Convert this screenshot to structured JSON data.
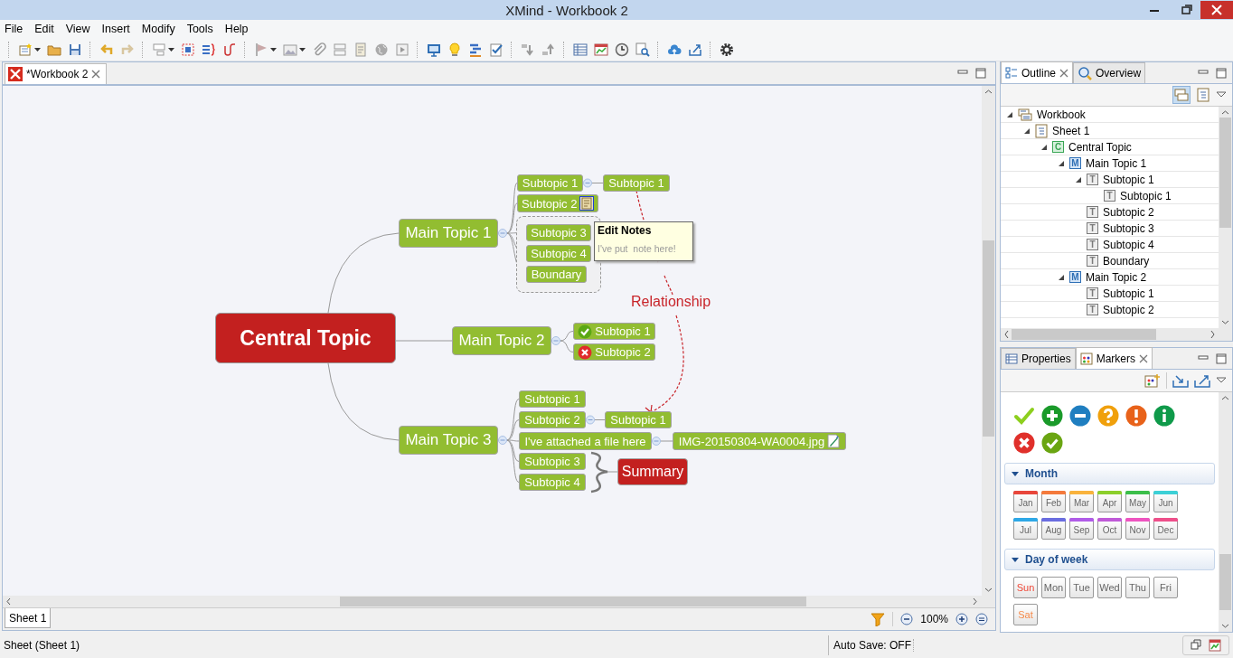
{
  "window": {
    "title": "XMind - Workbook 2"
  },
  "menu": [
    "File",
    "Edit",
    "View",
    "Insert",
    "Modify",
    "Tools",
    "Help"
  ],
  "editor": {
    "tabs": [
      {
        "label": "*Workbook 2",
        "selected": true
      }
    ],
    "mind_map": {
      "central_topic": "Central Topic",
      "main_topics": [
        {
          "label": "Main Topic 1",
          "subtopics": [
            {
              "label": "Subtopic 1",
              "children": [
                {
                  "label": "Subtopic 1"
                }
              ]
            },
            {
              "label": "Subtopic 2",
              "note": true
            },
            {
              "label": "Subtopic 3"
            },
            {
              "label": "Subtopic 4"
            },
            {
              "label": "Boundary"
            }
          ]
        },
        {
          "label": "Main Topic 2",
          "subtopics": [
            {
              "label": "Subtopic 1",
              "kind": "done"
            },
            {
              "label": "Subtopic 2",
              "kind": "cancelled"
            }
          ]
        },
        {
          "label": "Main Topic 3",
          "subtopics": [
            {
              "label": "Subtopic 1"
            },
            {
              "label": "Subtopic 2",
              "children": [
                {
                  "label": "Subtopic 1"
                }
              ]
            },
            {
              "label": "I've attached a file here",
              "children": [
                {
                  "label": "IMG-20150304-WA0004.jpg",
                  "attachment": true
                }
              ]
            },
            {
              "label": "Subtopic 3"
            },
            {
              "label": "Subtopic 4"
            }
          ]
        }
      ],
      "note_tooltip": {
        "title": "Edit Notes",
        "text": "I've put  note here!"
      },
      "relationship": "Relationship",
      "summary": "Summary"
    },
    "sheet_tabs": [
      {
        "label": "Sheet 1",
        "selected": true
      }
    ],
    "zoom": "100%"
  },
  "outline_panel": {
    "tabs": [
      {
        "label": "Outline",
        "selected": true
      },
      {
        "label": "Overview",
        "selected": false
      }
    ],
    "tree": [
      {
        "label": "Workbook",
        "kind": "workbook",
        "expanded": true,
        "children": [
          {
            "label": "Sheet 1",
            "kind": "sheet",
            "expanded": true,
            "children": [
              {
                "label": "Central Topic",
                "kind": "central",
                "badge": "C",
                "expanded": true,
                "children": [
                  {
                    "label": "Main Topic 1",
                    "kind": "main",
                    "badge": "M",
                    "expanded": true,
                    "children": [
                      {
                        "label": "Subtopic 1",
                        "kind": "topic",
                        "badge": "T",
                        "expanded": true,
                        "children": [
                          {
                            "label": "Subtopic 1",
                            "kind": "topic",
                            "badge": "T"
                          }
                        ]
                      },
                      {
                        "label": "Subtopic 2",
                        "kind": "topic",
                        "badge": "T"
                      },
                      {
                        "label": "Subtopic 3",
                        "kind": "topic",
                        "badge": "T"
                      },
                      {
                        "label": "Subtopic 4",
                        "kind": "topic",
                        "badge": "T"
                      },
                      {
                        "label": "Boundary",
                        "kind": "topic",
                        "badge": "T"
                      }
                    ]
                  },
                  {
                    "label": "Main Topic 2",
                    "kind": "main",
                    "badge": "M",
                    "expanded": true,
                    "children": [
                      {
                        "label": "Subtopic 1",
                        "kind": "topic",
                        "badge": "T"
                      },
                      {
                        "label": "Subtopic 2",
                        "kind": "topic",
                        "badge": "T"
                      }
                    ]
                  }
                ]
              }
            ]
          }
        ]
      }
    ]
  },
  "markers_panel": {
    "tabs": [
      {
        "label": "Properties",
        "selected": false
      },
      {
        "label": "Markers",
        "selected": true
      }
    ],
    "sections": [
      {
        "title": "Month",
        "expanded": true,
        "markers": [
          {
            "label": "Jan",
            "color": "#e8463b"
          },
          {
            "label": "Feb",
            "color": "#f47a3c"
          },
          {
            "label": "Mar",
            "color": "#f9b33d"
          },
          {
            "label": "Apr",
            "color": "#8ccf2b"
          },
          {
            "label": "May",
            "color": "#3cbf4a"
          },
          {
            "label": "Jun",
            "color": "#3cd0d6"
          },
          {
            "label": "Jul",
            "color": "#2ea8e6"
          },
          {
            "label": "Aug",
            "color": "#6a6de0"
          },
          {
            "label": "Sep",
            "color": "#b05ce8"
          },
          {
            "label": "Oct",
            "color": "#c05ad8"
          },
          {
            "label": "Nov",
            "color": "#ee54c0"
          },
          {
            "label": "Dec",
            "color": "#ee4f8a"
          }
        ]
      },
      {
        "title": "Day of week",
        "expanded": true,
        "markers": [
          {
            "label": "Sun",
            "color": "#f04a3a"
          },
          {
            "label": "Mon",
            "color": "#666666"
          },
          {
            "label": "Tue",
            "color": "#666666"
          },
          {
            "label": "Wed",
            "color": "#666666"
          },
          {
            "label": "Thu",
            "color": "#666666"
          },
          {
            "label": "Fri",
            "color": "#666666"
          },
          {
            "label": "Sat",
            "color": "#f58a4a"
          }
        ]
      }
    ]
  },
  "status_bar": {
    "left": "Sheet (Sheet 1)",
    "auto_save": "Auto Save: OFF"
  }
}
